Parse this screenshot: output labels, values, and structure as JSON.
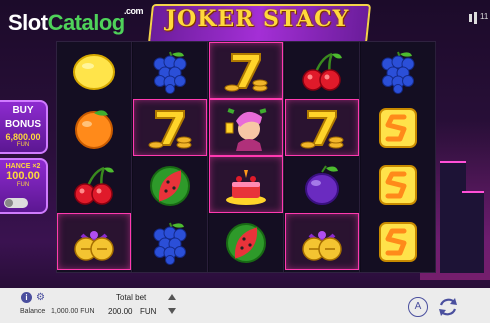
{
  "watermark": {
    "slot": "Slot",
    "catalog": "Catalog",
    "com": ".com"
  },
  "game": {
    "title": "JOKER STACY"
  },
  "header": {
    "number": "11"
  },
  "buy_bonus": {
    "title_line1": "BUY",
    "title_line2": "BONUS",
    "price": "6,800.00",
    "currency": "FUN"
  },
  "chance": {
    "label": "HANCE ×2",
    "price": "100.00",
    "currency": "FUN"
  },
  "reels": [
    [
      "lemon",
      "orange",
      "cherry",
      "bell"
    ],
    [
      "grapes",
      "seven",
      "watermelon",
      "grapes"
    ],
    [
      "seven",
      "joker",
      "cake",
      "watermelon"
    ],
    [
      "cherry",
      "seven",
      "plum",
      "bell"
    ],
    [
      "grapes",
      "scatter",
      "scatter",
      "scatter"
    ]
  ],
  "win_cells": [
    [
      1,
      1
    ],
    [
      2,
      0
    ],
    [
      2,
      1
    ],
    [
      2,
      2
    ],
    [
      3,
      1
    ],
    [
      0,
      3
    ],
    [
      3,
      3
    ]
  ],
  "bottom": {
    "balance_label": "Balance",
    "balance_value": "1,000.00 FUN",
    "totalbet_label": "Total bet",
    "totalbet_value": "200.00",
    "totalbet_currency": "FUN",
    "auto_label": "A"
  },
  "colors": {
    "accent": "#ff3ab0",
    "gold": "#ffd93b",
    "ui_blue": "#4a4f9e"
  }
}
